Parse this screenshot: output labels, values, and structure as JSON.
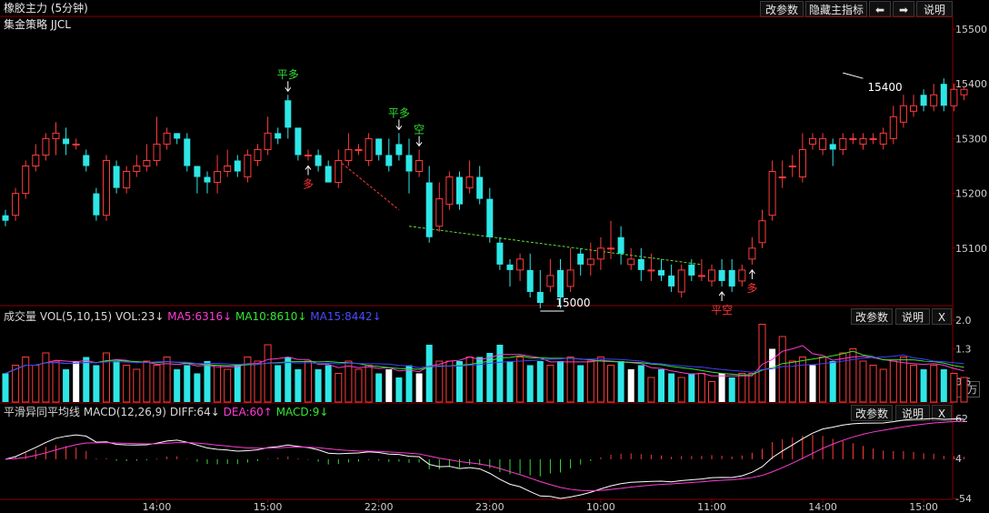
{
  "header": {
    "title": "橡胶主力 (5分钟)",
    "subtitle": "集金策略 JJCL",
    "buttons": {
      "params": "改参数",
      "hide_main": "隐藏主指标",
      "prev": "⬅",
      "next": "➡",
      "help": "说明"
    }
  },
  "colors": {
    "up": "#ff3b3b",
    "down": "#2ee6e6",
    "ma5": "#ff3bd6",
    "ma10": "#33e633",
    "ma15": "#4040ff",
    "signal_green": "#33dd33",
    "signal_red": "#ff3333",
    "trend": "#66dd33",
    "diff": "#ffffff",
    "dea": "#ff3bd6",
    "frame": "#8b0000"
  },
  "chart_data": [
    {
      "type": "candlestick",
      "name": "main",
      "ylim": [
        15000,
        15500
      ],
      "yticks": [
        15500,
        15400,
        15300,
        15200,
        15100
      ],
      "xticks": [
        "14:00",
        "15:00",
        "22:00",
        "23:00",
        "10:00",
        "11:00",
        "14:00",
        "15:00"
      ],
      "xtick_positions": [
        15,
        26,
        37,
        48,
        59,
        70,
        81,
        91
      ],
      "annotations": {
        "high": "15400",
        "low": "15000"
      },
      "signals": [
        {
          "i": 28,
          "text": "平多",
          "arrow": "down",
          "color": "green"
        },
        {
          "i": 30,
          "text": "多",
          "arrow": "up",
          "color": "red"
        },
        {
          "i": 39,
          "text": "平多",
          "arrow": "down",
          "color": "green"
        },
        {
          "i": 41,
          "text": "空",
          "arrow": "down",
          "color": "green"
        },
        {
          "i": 71,
          "text": "平空",
          "arrow": "up",
          "color": "red"
        },
        {
          "i": 74,
          "text": "多",
          "arrow": "up",
          "color": "red"
        }
      ],
      "candles": [
        [
          15160,
          15150,
          15170,
          15140
        ],
        [
          15160,
          15200,
          15210,
          15150
        ],
        [
          15200,
          15250,
          15260,
          15190
        ],
        [
          15250,
          15270,
          15290,
          15240
        ],
        [
          15270,
          15300,
          15310,
          15260
        ],
        [
          15300,
          15310,
          15330,
          15270
        ],
        [
          15300,
          15290,
          15320,
          15270
        ],
        [
          15290,
          15290,
          15300,
          15280
        ],
        [
          15270,
          15250,
          15280,
          15240
        ],
        [
          15200,
          15160,
          15210,
          15150
        ],
        [
          15160,
          15260,
          15270,
          15150
        ],
        [
          15250,
          15210,
          15260,
          15200
        ],
        [
          15210,
          15240,
          15250,
          15200
        ],
        [
          15240,
          15250,
          15270,
          15230
        ],
        [
          15250,
          15260,
          15290,
          15240
        ],
        [
          15260,
          15290,
          15340,
          15250
        ],
        [
          15290,
          15310,
          15320,
          15280
        ],
        [
          15310,
          15300,
          15310,
          15290
        ],
        [
          15300,
          15250,
          15310,
          15240
        ],
        [
          15250,
          15230,
          15240,
          15200
        ],
        [
          15230,
          15220,
          15240,
          15200
        ],
        [
          15220,
          15240,
          15270,
          15200
        ],
        [
          15240,
          15250,
          15280,
          15230
        ],
        [
          15260,
          15240,
          15270,
          15230
        ],
        [
          15230,
          15270,
          15280,
          15220
        ],
        [
          15260,
          15280,
          15290,
          15250
        ],
        [
          15280,
          15310,
          15340,
          15270
        ],
        [
          15310,
          15300,
          15320,
          15290
        ],
        [
          15370,
          15320,
          15380,
          15300
        ],
        [
          15320,
          15270,
          15300,
          15260
        ],
        [
          15270,
          15270,
          15280,
          15260
        ],
        [
          15270,
          15250,
          15280,
          15240
        ],
        [
          15250,
          15220,
          15260,
          15220
        ],
        [
          15220,
          15260,
          15280,
          15210
        ],
        [
          15260,
          15280,
          15310,
          15250
        ],
        [
          15280,
          15280,
          15290,
          15270
        ],
        [
          15260,
          15300,
          15310,
          15250
        ],
        [
          15300,
          15270,
          15300,
          15260
        ],
        [
          15270,
          15250,
          15300,
          15240
        ],
        [
          15290,
          15270,
          15310,
          15260
        ],
        [
          15270,
          15240,
          15300,
          15200
        ],
        [
          15240,
          15260,
          15280,
          15230
        ],
        [
          15220,
          15120,
          15250,
          15110
        ],
        [
          15140,
          15190,
          15220,
          15130
        ],
        [
          15180,
          15230,
          15240,
          15170
        ],
        [
          15230,
          15180,
          15240,
          15170
        ],
        [
          15210,
          15230,
          15260,
          15200
        ],
        [
          15230,
          15190,
          15250,
          15180
        ],
        [
          15190,
          15120,
          15210,
          15110
        ],
        [
          15110,
          15070,
          15120,
          15060
        ],
        [
          15070,
          15060,
          15080,
          15030
        ],
        [
          15060,
          15080,
          15090,
          15040
        ],
        [
          15060,
          15020,
          15090,
          15010
        ],
        [
          15020,
          15000,
          15060,
          14990
        ],
        [
          15030,
          15050,
          15080,
          15020
        ],
        [
          15060,
          15010,
          15080,
          14990
        ],
        [
          15030,
          15060,
          15100,
          15020
        ],
        [
          15090,
          15070,
          15100,
          15050
        ],
        [
          15070,
          15080,
          15110,
          15050
        ],
        [
          15080,
          15100,
          15120,
          15060
        ],
        [
          15100,
          15100,
          15150,
          15080
        ],
        [
          15120,
          15090,
          15140,
          15070
        ],
        [
          15070,
          15080,
          15100,
          15060
        ],
        [
          15080,
          15060,
          15100,
          15040
        ],
        [
          15060,
          15060,
          15090,
          15040
        ],
        [
          15060,
          15050,
          15080,
          15040
        ],
        [
          15050,
          15030,
          15070,
          15020
        ],
        [
          15020,
          15060,
          15070,
          15010
        ],
        [
          15070,
          15050,
          15080,
          15040
        ],
        [
          15050,
          15050,
          15080,
          15040
        ],
        [
          15040,
          15060,
          15070,
          15030
        ],
        [
          15060,
          15040,
          15080,
          15030
        ],
        [
          15060,
          15030,
          15080,
          15020
        ],
        [
          15040,
          15060,
          15070,
          15030
        ],
        [
          15080,
          15100,
          15120,
          15070
        ],
        [
          15110,
          15150,
          15170,
          15100
        ],
        [
          15160,
          15240,
          15260,
          15150
        ],
        [
          15230,
          15230,
          15260,
          15210
        ],
        [
          15250,
          15250,
          15270,
          15230
        ],
        [
          15230,
          15280,
          15310,
          15220
        ],
        [
          15290,
          15300,
          15310,
          15280
        ],
        [
          15280,
          15300,
          15310,
          15270
        ],
        [
          15290,
          15280,
          15300,
          15250
        ],
        [
          15280,
          15300,
          15310,
          15270
        ],
        [
          15300,
          15300,
          15310,
          15290
        ],
        [
          15290,
          15300,
          15310,
          15280
        ],
        [
          15300,
          15300,
          15310,
          15290
        ],
        [
          15290,
          15310,
          15320,
          15280
        ],
        [
          15300,
          15340,
          15360,
          15290
        ],
        [
          15330,
          15360,
          15380,
          15320
        ],
        [
          15350,
          15360,
          15380,
          15340
        ],
        [
          15380,
          15360,
          15390,
          15350
        ],
        [
          15360,
          15380,
          15400,
          15350
        ],
        [
          15400,
          15360,
          15410,
          15350
        ],
        [
          15360,
          15390,
          15400,
          15350
        ],
        [
          15380,
          15390,
          15395,
          15370
        ]
      ]
    },
    {
      "type": "bar",
      "name": "volume",
      "label": "成交量",
      "params": "VOL(5,10,15)",
      "readouts": {
        "vol": "VOL:23↓",
        "ma5": "MA5:6316↓",
        "ma10": "MA10:8610↓",
        "ma15": "MA15:8442↓"
      },
      "ylim": [
        0,
        2.0
      ],
      "yticks": [
        "2.0",
        "1.3",
        "0.5"
      ],
      "unit": "×万",
      "values": [
        0.7,
        0.9,
        1.1,
        0.9,
        1.2,
        1.0,
        0.8,
        1.0,
        1.1,
        0.9,
        1.2,
        1.0,
        0.9,
        0.8,
        1.0,
        0.9,
        1.1,
        0.8,
        0.9,
        0.7,
        1.0,
        0.9,
        0.8,
        0.9,
        1.1,
        1.0,
        1.4,
        0.9,
        1.1,
        0.8,
        1.0,
        0.8,
        0.9,
        0.7,
        1.0,
        0.8,
        0.9,
        0.7,
        0.8,
        0.6,
        0.9,
        0.7,
        1.4,
        1.0,
        1.0,
        1.0,
        1.1,
        1.1,
        1.2,
        1.4,
        1.0,
        1.1,
        0.9,
        1.0,
        0.9,
        1.0,
        1.1,
        0.9,
        1.0,
        1.1,
        0.9,
        1.0,
        0.8,
        0.9,
        0.6,
        0.8,
        0.7,
        0.6,
        0.7,
        0.7,
        0.5,
        0.7,
        0.6,
        0.7,
        0.7,
        1.9,
        1.3,
        1.6,
        1.0,
        1.1,
        0.9,
        1.1,
        1.0,
        1.2,
        1.3,
        1.0,
        0.9,
        0.8,
        1.0,
        1.1,
        0.9,
        0.8,
        0.9,
        0.8,
        0.7,
        0.6
      ],
      "up_white": [
        7,
        38,
        41,
        62,
        71,
        76,
        80
      ]
    },
    {
      "type": "macd",
      "name": "macd",
      "label": "平滑异同平均线",
      "params": "MACD(12,26,9)",
      "readouts": {
        "diff": "DIFF:64↓",
        "dea": "DEA:60↑",
        "macd": "MACD:9↓"
      },
      "ylim": [
        -54,
        62
      ],
      "yticks": [
        "62",
        "4",
        "-54"
      ]
    }
  ],
  "panel_buttons": {
    "params": "改参数",
    "help": "说明",
    "close": "X"
  }
}
